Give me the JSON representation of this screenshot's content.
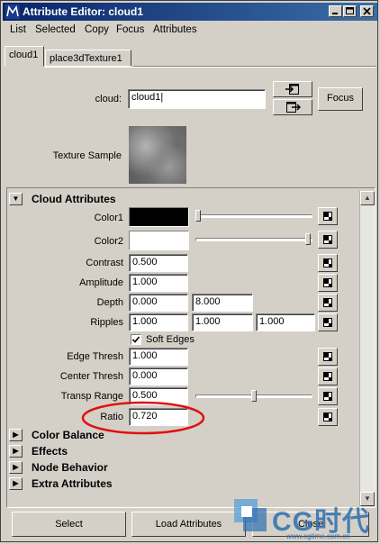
{
  "window": {
    "title": "Attribute Editor: cloud1"
  },
  "menu": [
    "List",
    "Selected",
    "Copy",
    "Focus",
    "Attributes"
  ],
  "tabs": [
    "cloud1",
    "place3dTexture1"
  ],
  "node": {
    "type_label": "cloud:",
    "name_value": "cloud1",
    "focus_label": "Focus",
    "texture_sample_label": "Texture Sample"
  },
  "sections": {
    "cloud_attributes": "Cloud Attributes",
    "color_balance": "Color Balance",
    "effects": "Effects",
    "node_behavior": "Node Behavior",
    "extra_attributes": "Extra Attributes"
  },
  "attributes": {
    "color1": {
      "label": "Color1",
      "color": "#000000",
      "slider_fraction": 0.0
    },
    "color2": {
      "label": "Color2",
      "color": "#ffffff",
      "slider_fraction": 1.0
    },
    "contrast": {
      "label": "Contrast",
      "value": "0.500"
    },
    "amplitude": {
      "label": "Amplitude",
      "value": "1.000"
    },
    "depth": {
      "label": "Depth",
      "v1": "0.000",
      "v2": "8.000"
    },
    "ripples": {
      "label": "Ripples",
      "v1": "1.000",
      "v2": "1.000",
      "v3": "1.000"
    },
    "soft_edges": {
      "label": "Soft Edges",
      "checked": true
    },
    "edge_thresh": {
      "label": "Edge Thresh",
      "value": "1.000"
    },
    "center_thresh": {
      "label": "Center Thresh",
      "value": "0.000"
    },
    "transp_range": {
      "label": "Transp Range",
      "value": "0.500",
      "slider_fraction": 0.5
    },
    "ratio": {
      "label": "Ratio",
      "value": "0.720"
    }
  },
  "buttons": {
    "select": "Select",
    "load_attributes": "Load Attributes",
    "close": "Close"
  },
  "watermark": {
    "logo": "CG时代",
    "url": "www.cgtime.com.cn"
  },
  "colors": {
    "title_bar": "#0a246a",
    "highlight_circle": "#e01010",
    "window_bg": "#d4d0c8"
  }
}
